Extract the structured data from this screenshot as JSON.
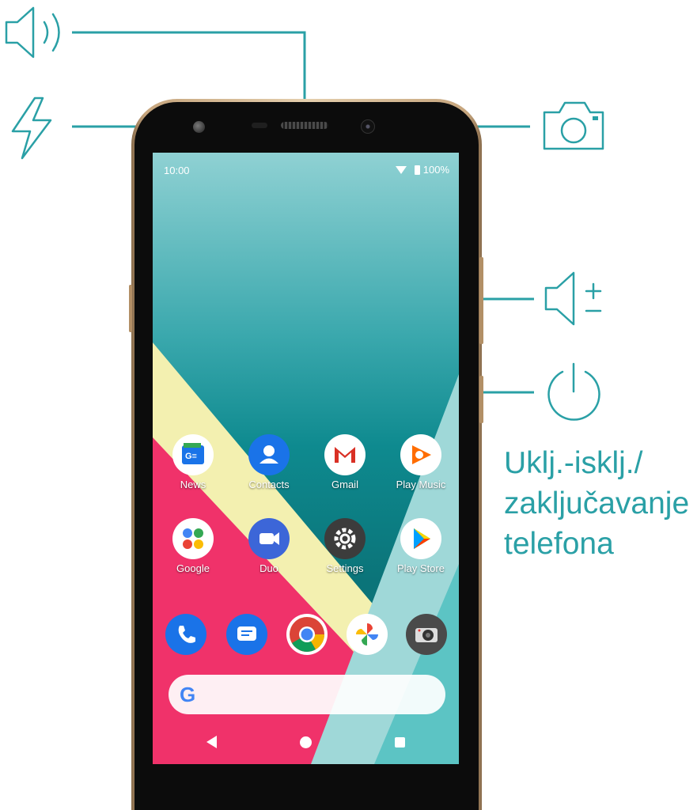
{
  "callouts": {
    "speaker": "speaker-icon",
    "flash": "flash-icon",
    "camera": "camera-icon",
    "volume": "volume-icon",
    "power": "power-icon",
    "line_color": "#2aa0a6"
  },
  "power_caption": {
    "line1": "Uklj.-isklj./",
    "line2": "zaključavanje",
    "line3": "telefona"
  },
  "phone": {
    "status": {
      "time": "10:00",
      "battery": "100%"
    },
    "apps_row1": [
      {
        "label": "News",
        "icon": "news-icon",
        "color": "#ffffff"
      },
      {
        "label": "Contacts",
        "icon": "contacts-icon",
        "color": "#1a73e8"
      },
      {
        "label": "Gmail",
        "icon": "gmail-icon",
        "color": "#ffffff"
      },
      {
        "label": "Play Music",
        "icon": "play-music-icon",
        "color": "#ffffff"
      }
    ],
    "apps_row2": [
      {
        "label": "Google",
        "icon": "google-folder-icon",
        "color": "#ffffff"
      },
      {
        "label": "Duo",
        "icon": "duo-icon",
        "color": "#3c66d8"
      },
      {
        "label": "Settings",
        "icon": "settings-icon",
        "color": "#3c3c3c"
      },
      {
        "label": "Play Store",
        "icon": "play-store-icon",
        "color": "#ffffff"
      }
    ],
    "dock": [
      {
        "icon": "phone-icon",
        "color": "#1a73e8"
      },
      {
        "icon": "messages-icon",
        "color": "#1a73e8"
      },
      {
        "icon": "chrome-icon",
        "color": "#ffffff"
      },
      {
        "icon": "photos-icon",
        "color": "#ffffff"
      },
      {
        "icon": "camera-app-icon",
        "color": "#4a4a4a"
      }
    ],
    "search_logo": "G"
  }
}
